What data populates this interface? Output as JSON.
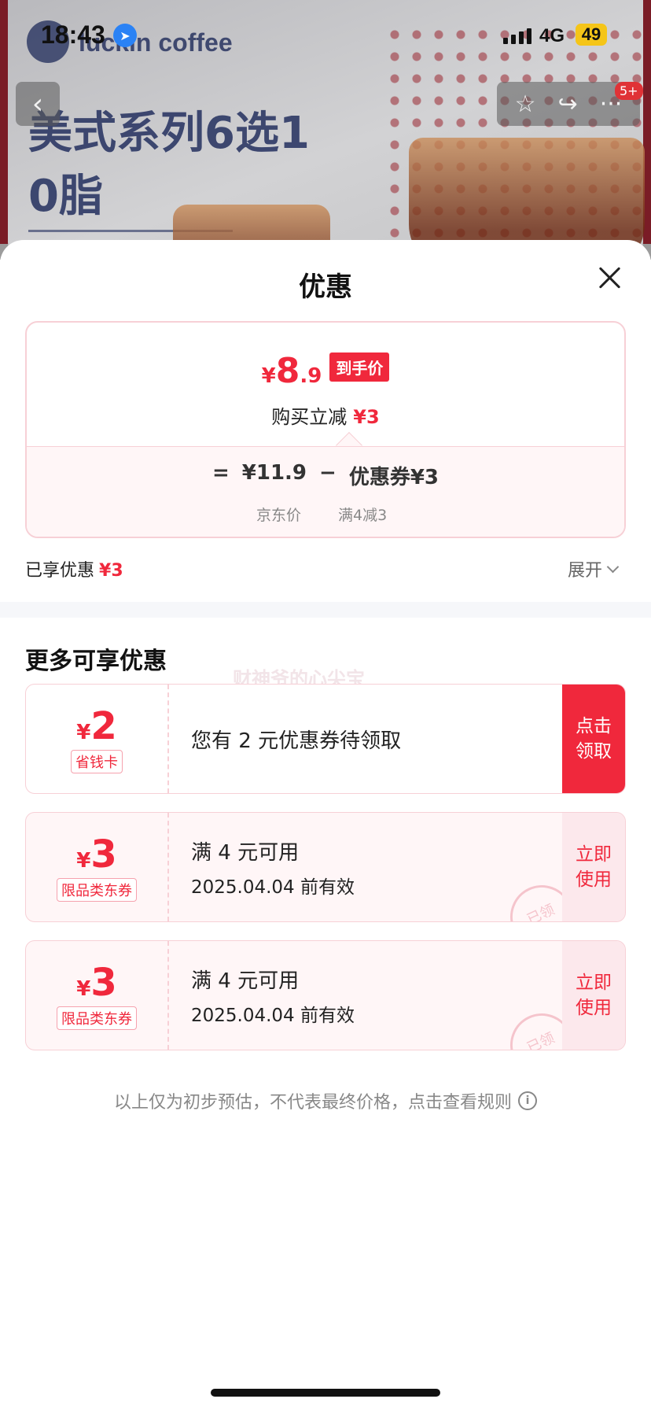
{
  "status_bar": {
    "time": "18:43",
    "network": "4G",
    "battery": "49"
  },
  "banner": {
    "brand": "luckin coffee",
    "title_line1": "美式系列6选1",
    "title_line2": "0脂",
    "cart_badge": "5+"
  },
  "sheet": {
    "title": "优惠",
    "price": {
      "currency": "¥",
      "integer": "8",
      "decimal": ".9",
      "tag": "到手价",
      "instant_label": "购买立减",
      "instant_amount": "¥3"
    },
    "formula": {
      "equals": "=",
      "jd_price": "¥11.9",
      "minus": "−",
      "coupon": "优惠券¥3",
      "jd_price_label": "京东价",
      "coupon_rule": "满4减3"
    },
    "enjoyed_label": "已享优惠",
    "enjoyed_amount": "¥3",
    "expand_label": "展开",
    "more_title": "更多可享优惠",
    "watermark": "财神爷的心尖宝",
    "coupons": [
      {
        "currency": "¥",
        "amount": "2",
        "tag": "省钱卡",
        "line1": "您有 2 元优惠券待领取",
        "line2": "",
        "action": "点击\n领取"
      },
      {
        "currency": "¥",
        "amount": "3",
        "tag": "限品类东券",
        "line1": "满 4 元可用",
        "line2": "2025.04.04 前有效",
        "action": "立即\n使用",
        "stamp": "已领"
      },
      {
        "currency": "¥",
        "amount": "3",
        "tag": "限品类东券",
        "line1": "满 4 元可用",
        "line2": "2025.04.04 前有效",
        "action": "立即\n使用",
        "stamp": "已领"
      }
    ],
    "disclaimer": "以上仅为初步预估，不代表最终价格，点击查看规则"
  },
  "colors": {
    "accent_red": "#f0283c",
    "border_pink": "#f7d0d6",
    "stamp_pink": "#f5c4cc"
  },
  "icons": [
    "location-arrow-icon",
    "back-arrow-icon",
    "star-icon",
    "share-icon",
    "more-icon",
    "close-icon",
    "chevron-down-icon",
    "info-icon"
  ]
}
